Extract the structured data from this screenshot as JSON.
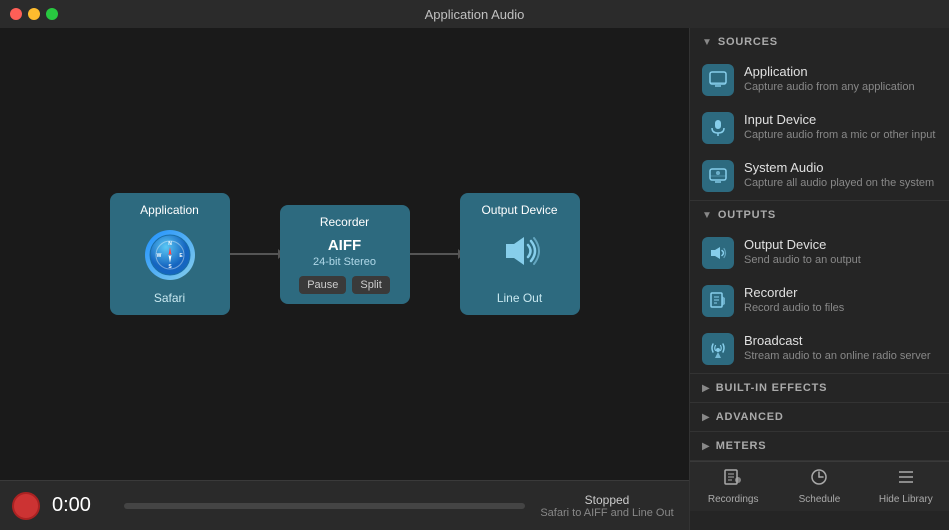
{
  "titleBar": {
    "title": "Application Audio"
  },
  "pipeline": {
    "nodes": [
      {
        "id": "application",
        "label": "Application",
        "sublabel": "Safari",
        "type": "application"
      },
      {
        "id": "recorder",
        "label": "Recorder",
        "format": "AIFF",
        "quality": "24-bit Stereo",
        "type": "recorder",
        "buttons": [
          "Pause",
          "Split"
        ]
      },
      {
        "id": "output",
        "label": "Output Device",
        "sublabel": "Line Out",
        "type": "output"
      }
    ]
  },
  "statusBar": {
    "time": "0:00",
    "status": "Stopped",
    "subStatus": "Safari to AIFF and Line Out",
    "recordButtonLabel": "Record"
  },
  "sidebar": {
    "sections": [
      {
        "id": "sources",
        "title": "SOURCES",
        "expanded": true,
        "items": [
          {
            "id": "application",
            "title": "Application",
            "desc": "Capture audio from any application",
            "icon": "🖥"
          },
          {
            "id": "input-device",
            "title": "Input Device",
            "desc": "Capture audio from a mic or other input",
            "icon": "🎤"
          },
          {
            "id": "system-audio",
            "title": "System Audio",
            "desc": "Capture all audio played on the system",
            "icon": "🖥"
          }
        ]
      },
      {
        "id": "outputs",
        "title": "OUTPUTS",
        "expanded": true,
        "items": [
          {
            "id": "output-device",
            "title": "Output Device",
            "desc": "Send audio to an output",
            "icon": "🔊"
          },
          {
            "id": "recorder",
            "title": "Recorder",
            "desc": "Record audio to files",
            "icon": "📄"
          },
          {
            "id": "broadcast",
            "title": "Broadcast",
            "desc": "Stream audio to an online radio server",
            "icon": "📡"
          }
        ]
      },
      {
        "id": "built-in-effects",
        "title": "BUILT-IN EFFECTS",
        "expanded": false,
        "items": []
      },
      {
        "id": "advanced",
        "title": "ADVANCED",
        "expanded": false,
        "items": []
      },
      {
        "id": "meters",
        "title": "METERS",
        "expanded": false,
        "items": []
      }
    ]
  },
  "bottomTabs": [
    {
      "id": "recordings",
      "label": "Recordings",
      "icon": "📋"
    },
    {
      "id": "schedule",
      "label": "Schedule",
      "icon": "🕐"
    },
    {
      "id": "hide-library",
      "label": "Hide Library",
      "icon": "☰"
    }
  ],
  "icons": {
    "application": "🖥",
    "input-device": "🎤",
    "system-audio": "💻",
    "output-device": "🔊",
    "recorder-file": "📄",
    "broadcast": "📡"
  }
}
